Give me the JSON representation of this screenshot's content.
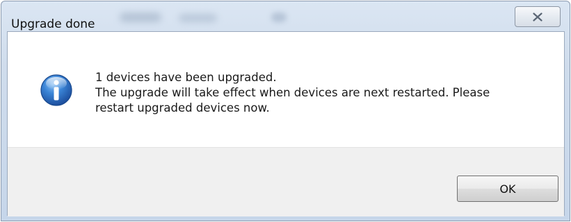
{
  "window": {
    "title": "Upgrade done"
  },
  "icons": {
    "close": "close-icon",
    "info": "info-icon"
  },
  "message": {
    "line1": "1 devices have been upgraded.",
    "line2": "The upgrade will take effect when devices are next restarted. Please",
    "line3": "restart upgraded devices now."
  },
  "buttons": {
    "ok_label": "OK"
  },
  "colors": {
    "titlebar": "#cfdcec",
    "footer": "#f0f0f0",
    "info_icon_blue": "#2f6fc4"
  }
}
